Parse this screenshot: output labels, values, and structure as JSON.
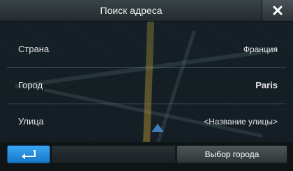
{
  "window": {
    "title": "Поиск адреса"
  },
  "rows": [
    {
      "label": "Страна",
      "value": "Франция"
    },
    {
      "label": "Город",
      "value": "Paris"
    },
    {
      "label": "Улица",
      "value": "<Название улицы>"
    }
  ],
  "bottom": {
    "select_city_label": "Выбор города"
  },
  "icons": {
    "close": "close-icon",
    "back": "back-arrow-icon"
  },
  "colors": {
    "accent": "#1f8ee0",
    "text": "#ffffff"
  }
}
